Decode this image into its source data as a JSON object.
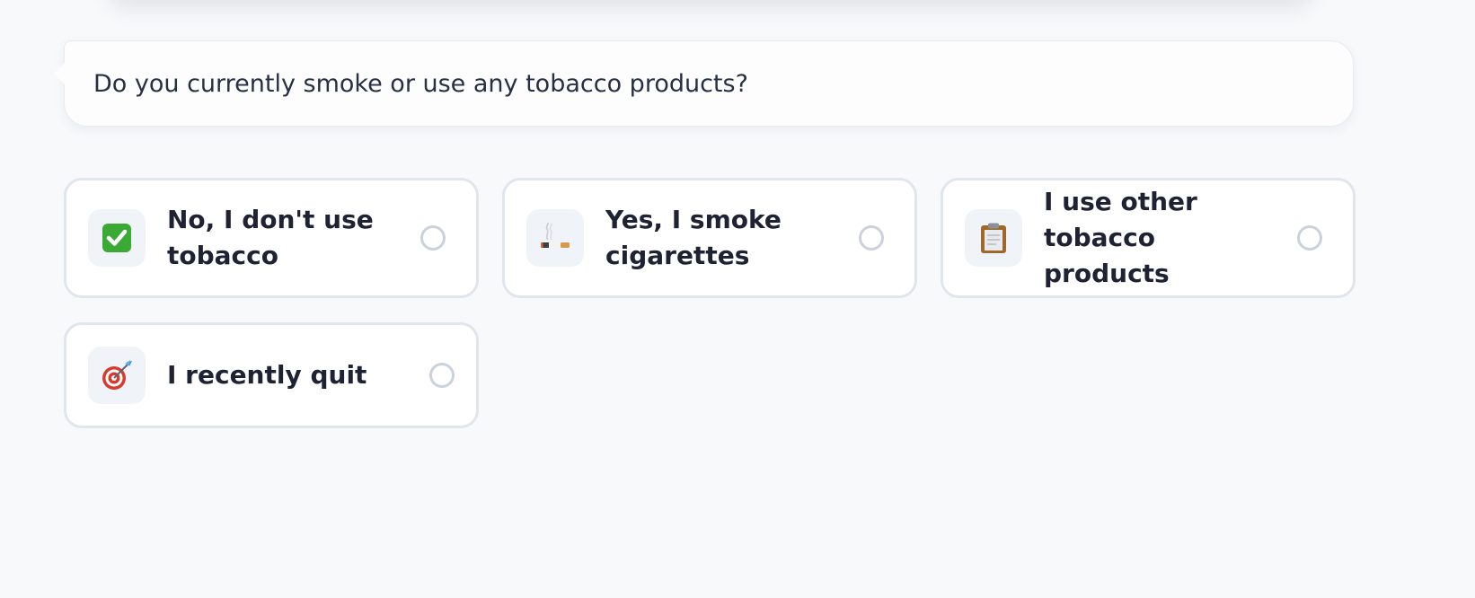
{
  "question": {
    "text": "Do you currently smoke or use any tobacco products?"
  },
  "options": [
    {
      "label": "No, I don't use tobacco",
      "icon": "check-mark-icon",
      "selected": false
    },
    {
      "label": "Yes, I smoke cigarettes",
      "icon": "cigarette-icon",
      "selected": false
    },
    {
      "label": "I use other tobacco products",
      "icon": "clipboard-icon",
      "selected": false
    },
    {
      "label": "I recently quit",
      "icon": "target-icon",
      "selected": false
    }
  ],
  "colors": {
    "background": "#f8f9fb",
    "card_border": "#e1e5ec",
    "radio_border": "#cbd2de",
    "text": "#1e2233",
    "check_green": "#3aaa35"
  }
}
